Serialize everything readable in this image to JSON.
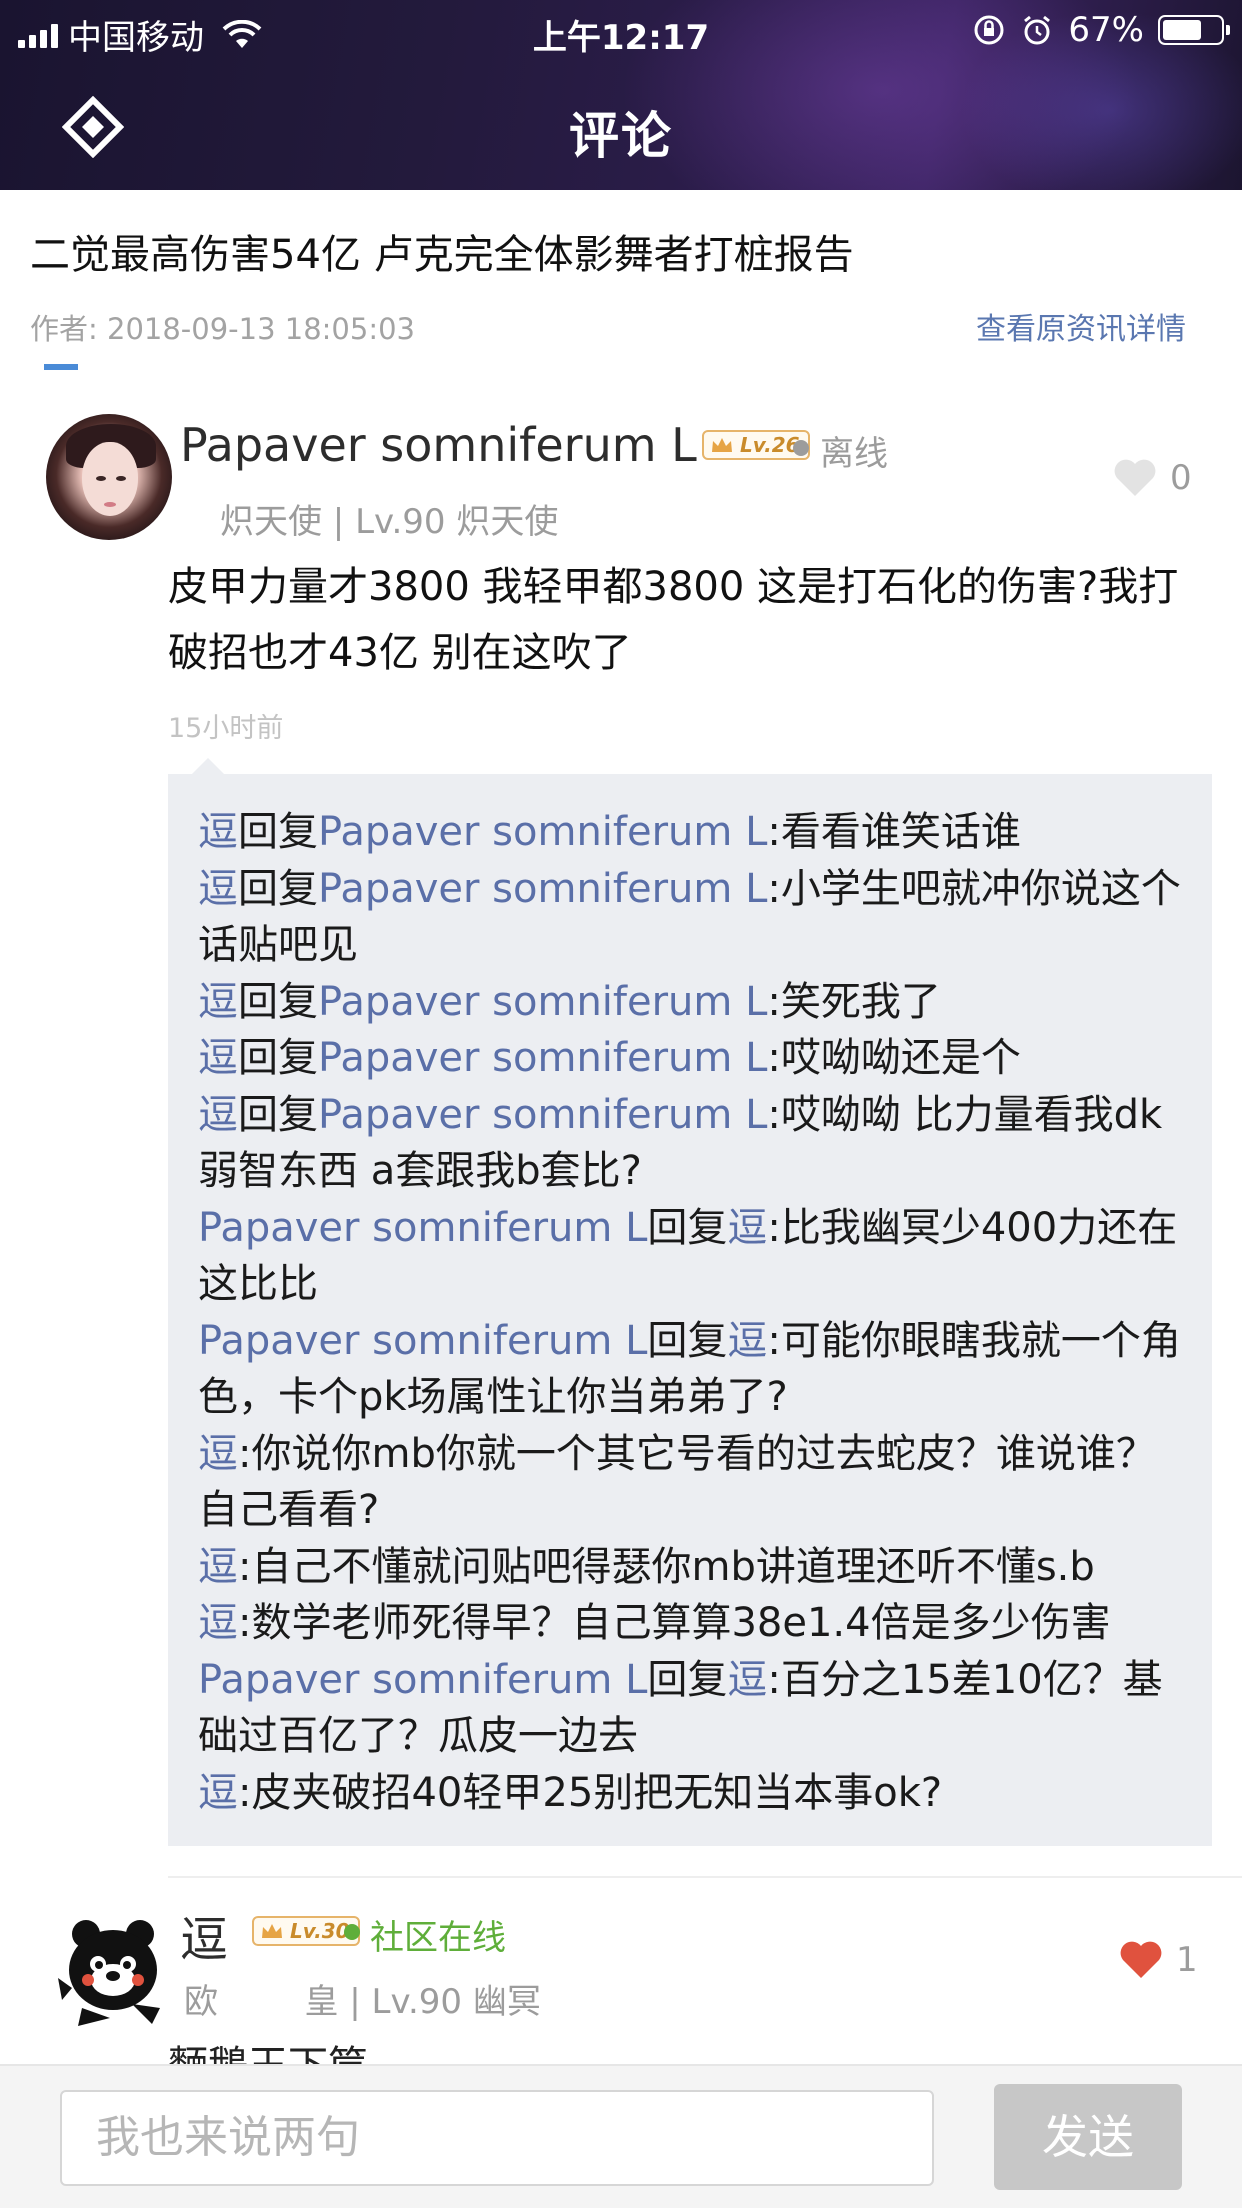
{
  "status_bar": {
    "carrier": "中国移动",
    "time": "上午12:17",
    "battery": "67%",
    "battery_level": 0.67
  },
  "nav": {
    "title": "评论",
    "back_icon": "diamond-back-icon"
  },
  "article": {
    "title": "二觉最高伤害54亿 卢克完全体影舞者打桩报告",
    "author": "作者: 2018-09-13 18:05:03",
    "view_source": "查看原资讯详情"
  },
  "comments": [
    {
      "name": "Papaver somniferum L",
      "level_badge": "Lv.26",
      "status": "离线",
      "status_color": "#9c9c9c",
      "meta": "炽天使 | Lv.90 炽天使",
      "likes": "0",
      "liked": false,
      "text": "皮甲力量才3800  我轻甲都3800  这是打石化的伤害?我打破招也才43亿  别在这吹了",
      "time": "15小时前",
      "replies": [
        {
          "from": "逗",
          "verb": "回复",
          "to": "Papaver somniferum L",
          "text": ":看看谁笑话谁"
        },
        {
          "from": "逗",
          "verb": "回复",
          "to": "Papaver somniferum L",
          "text": ":小学生吧就冲你说这个话贴吧见"
        },
        {
          "from": "逗",
          "verb": "回复",
          "to": "Papaver somniferum L",
          "text": ":笑死我了"
        },
        {
          "from": "逗",
          "verb": "回复",
          "to": "Papaver somniferum L",
          "text": ":哎呦呦还是个"
        },
        {
          "from": "逗",
          "verb": "回复",
          "to": "Papaver somniferum L",
          "text": ":哎呦呦 比力量看我dk弱智东西 a套跟我b套比?"
        },
        {
          "from": "Papaver somniferum L",
          "verb": "回复",
          "to": "逗",
          "text": ":比我幽冥少400力还在这比比"
        },
        {
          "from": "Papaver somniferum L",
          "verb": "回复",
          "to": "逗",
          "text": ":可能你眼瞎我就一个角色，卡个pk场属性让你当弟弟了?"
        },
        {
          "from": "逗",
          "verb": "",
          "to": "",
          "text": ":你说你mb你就一个其它号看的过去蛇皮？谁说谁？自己看看?"
        },
        {
          "from": "逗",
          "verb": "",
          "to": "",
          "text": ":自己不懂就问贴吧得瑟你mb讲道理还听不懂s.b"
        },
        {
          "from": "逗",
          "verb": "",
          "to": "",
          "text": ":数学老师死得早？自己算算38e1.4倍是多少伤害"
        },
        {
          "from": "Papaver somniferum L",
          "verb": "回复",
          "to": "逗",
          "text": ":百分之15差10亿？基础过百亿了？瓜皮一边去"
        },
        {
          "from": "逗",
          "verb": "",
          "to": "",
          "text": ":皮夹破招40轻甲25别把无知当本事ok?"
        }
      ]
    },
    {
      "name": "逗",
      "level_badge": "Lv.30",
      "status": "社区在线",
      "status_color": "#5fae3a",
      "meta": "欧        皇 | Lv.90 幽冥",
      "likes": "1",
      "liked": true,
      "text": "麵鵝王下筐"
    }
  ],
  "input": {
    "placeholder": "我也来说两句",
    "send_label": "发送"
  },
  "colors": {
    "username_link": "#5a6fa8",
    "like_active": "#e0523e",
    "like_inactive": "#e3e3e3",
    "online": "#5fae3a"
  }
}
